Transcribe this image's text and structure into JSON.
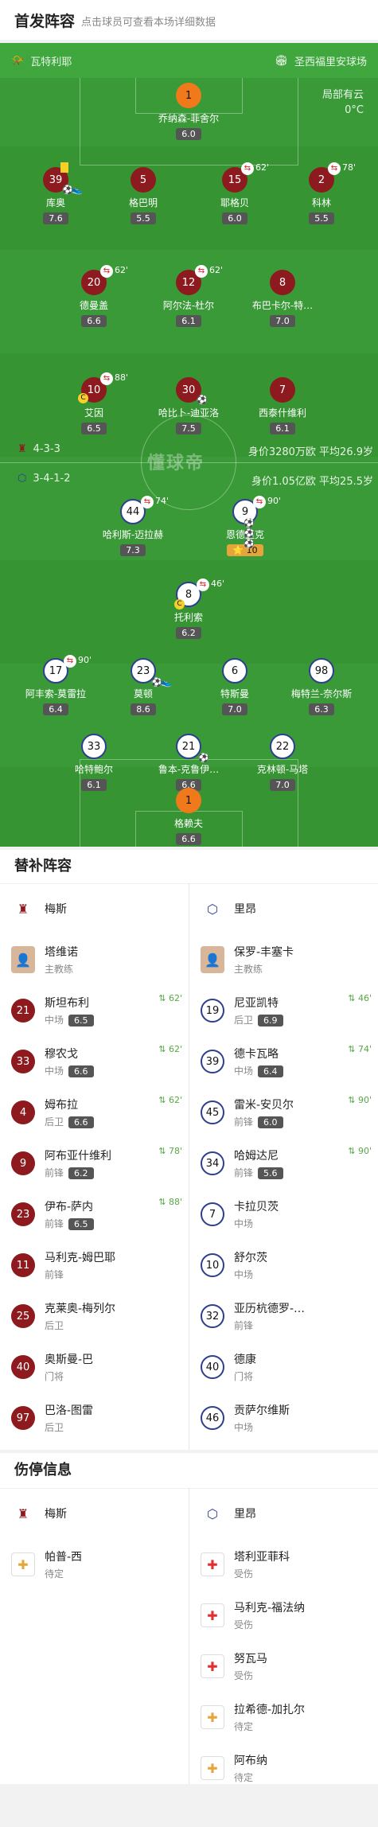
{
  "header": {
    "title": "首发阵容",
    "subtitle": "点击球员可查看本场详细数据"
  },
  "venue": {
    "referee": "瓦特利耶",
    "stadium": "圣西福里安球场"
  },
  "weather": {
    "desc": "局部有云",
    "temp": "0°C"
  },
  "home": {
    "formation": "4-3-3",
    "value": "身价3280万欧 平均26.9岁"
  },
  "away": {
    "formation": "3-4-1-2",
    "value": "身价1.05亿欧 平均25.5岁"
  },
  "watermark": "懂球帝",
  "lineup_players": [
    {
      "num": "1",
      "name": "乔纳森-菲舍尔",
      "rating": "6.0"
    },
    {
      "num": "39",
      "name": "库奥",
      "rating": "7.6"
    },
    {
      "num": "5",
      "name": "格巴明",
      "rating": "5.5"
    },
    {
      "num": "15",
      "name": "耶格贝",
      "rating": "6.0",
      "sub": "62'"
    },
    {
      "num": "2",
      "name": "科林",
      "rating": "5.5",
      "sub": "78'"
    },
    {
      "num": "20",
      "name": "德曼盖",
      "rating": "6.6",
      "sub": "62'"
    },
    {
      "num": "12",
      "name": "阿尔法-杜尔",
      "rating": "6.1",
      "sub": "62'"
    },
    {
      "num": "8",
      "name": "布巴卡尔-特…",
      "rating": "7.0"
    },
    {
      "num": "10",
      "name": "艾因",
      "rating": "6.5",
      "sub": "88'"
    },
    {
      "num": "30",
      "name": "哈比卜-迪亚洛",
      "rating": "7.5"
    },
    {
      "num": "7",
      "name": "西泰什维利",
      "rating": "6.1"
    },
    {
      "num": "44",
      "name": "哈利斯-迈拉赫",
      "rating": "7.3",
      "sub": "74'"
    },
    {
      "num": "9",
      "name": "恩德里克",
      "rating": "10",
      "sub": "90'"
    },
    {
      "num": "8",
      "name": "托利索",
      "rating": "6.2",
      "sub": "46'"
    },
    {
      "num": "17",
      "name": "阿丰索-莫雷拉",
      "rating": "6.4",
      "sub": "90'"
    },
    {
      "num": "23",
      "name": "莫顿",
      "rating": "8.6"
    },
    {
      "num": "6",
      "name": "特斯曼",
      "rating": "7.0"
    },
    {
      "num": "98",
      "name": "梅特兰-奈尔斯",
      "rating": "6.3"
    },
    {
      "num": "33",
      "name": "哈特鲍尔",
      "rating": "6.1"
    },
    {
      "num": "21",
      "name": "鲁本-克鲁伊…",
      "rating": "6.6"
    },
    {
      "num": "22",
      "name": "克林顿-马塔",
      "rating": "7.0"
    },
    {
      "num": "1",
      "name": "格赖夫",
      "rating": "6.6"
    }
  ],
  "subs": {
    "title": "替补阵容",
    "home_team": "梅斯",
    "away_team": "里昂",
    "home_coach": {
      "name": "塔维诺",
      "role": "主教练"
    },
    "away_coach": {
      "name": "保罗-丰塞卡",
      "role": "主教练"
    },
    "home": [
      {
        "num": "21",
        "name": "斯坦布利",
        "pos": "中场",
        "rating": "6.5",
        "sub": "62'"
      },
      {
        "num": "33",
        "name": "穆农戈",
        "pos": "中场",
        "rating": "6.6",
        "sub": "62'"
      },
      {
        "num": "4",
        "name": "姆布拉",
        "pos": "后卫",
        "rating": "6.6",
        "sub": "62'"
      },
      {
        "num": "9",
        "name": "阿布亚什维利",
        "pos": "前锋",
        "rating": "6.2",
        "sub": "78'"
      },
      {
        "num": "23",
        "name": "伊布-萨内",
        "pos": "前锋",
        "rating": "6.5",
        "sub": "88'"
      },
      {
        "num": "11",
        "name": "马利克-姆巴耶",
        "pos": "前锋"
      },
      {
        "num": "25",
        "name": "克莱奥-梅列尔",
        "pos": "后卫"
      },
      {
        "num": "40",
        "name": "奥斯曼-巴",
        "pos": "门将"
      },
      {
        "num": "97",
        "name": "巴洛-图雷",
        "pos": "后卫"
      }
    ],
    "away": [
      {
        "num": "19",
        "name": "尼亚凯特",
        "pos": "后卫",
        "rating": "6.9",
        "sub": "46'"
      },
      {
        "num": "39",
        "name": "德卡瓦略",
        "pos": "中场",
        "rating": "6.4",
        "sub": "74'"
      },
      {
        "num": "45",
        "name": "雷米-安贝尔",
        "pos": "前锋",
        "rating": "6.0",
        "sub": "90'"
      },
      {
        "num": "34",
        "name": "哈姆达尼",
        "pos": "前锋",
        "rating": "5.6",
        "sub": "90'"
      },
      {
        "num": "7",
        "name": "卡拉贝茨",
        "pos": "中场"
      },
      {
        "num": "10",
        "name": "舒尔茨",
        "pos": "中场"
      },
      {
        "num": "32",
        "name": "亚历杭德罗-…",
        "pos": "前锋"
      },
      {
        "num": "40",
        "name": "德康",
        "pos": "门将"
      },
      {
        "num": "46",
        "name": "贡萨尔维斯",
        "pos": "中场"
      }
    ]
  },
  "injuries": {
    "title": "伤停信息",
    "home_team": "梅斯",
    "away_team": "里昂",
    "home": [
      {
        "name": "帕普-西",
        "status": "待定",
        "type": "yellow"
      }
    ],
    "away": [
      {
        "name": "塔利亚菲科",
        "status": "受伤",
        "type": "red"
      },
      {
        "name": "马利克-福法纳",
        "status": "受伤",
        "type": "red"
      },
      {
        "name": "努瓦马",
        "status": "受伤",
        "type": "red"
      },
      {
        "name": "拉希德-加扎尔",
        "status": "待定",
        "type": "yellow"
      },
      {
        "name": "阿布纳",
        "status": "待定",
        "type": "yellow"
      }
    ]
  }
}
